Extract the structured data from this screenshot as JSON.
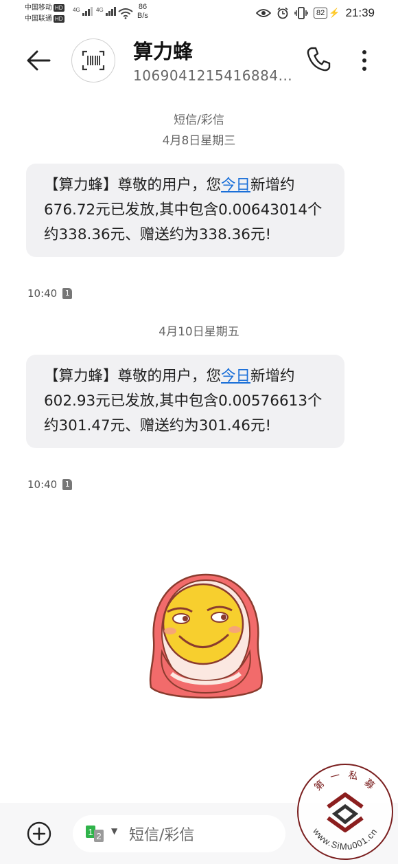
{
  "status_bar": {
    "carrier1": "中国移动",
    "carrier2": "中国联通",
    "hd_label": "HD",
    "net_type": "4G",
    "net_speed_value": "86",
    "net_speed_unit": "B/s",
    "battery": "82",
    "time": "21:39"
  },
  "header": {
    "title": "算力蜂",
    "number": "1069041215416884..."
  },
  "messages": {
    "type_label": "短信/彩信",
    "date1": "4月8日星期三",
    "msg1": {
      "text_before_link": "【算力蜂】尊敬的用户，您",
      "link": "今日",
      "text_after_link": "新增约676.72元已发放,其中包含0.00643014个约338.36元、赠送约为338.36元!",
      "time": "10:40",
      "sim": "1"
    },
    "date2": "4月10日星期五",
    "msg2": {
      "text_before_link": "【算力蜂】尊敬的用户，您",
      "link": "今日",
      "text_after_link": "新增约602.93元已发放,其中包含0.00576613个约301.47元、赠送约为301.46元!",
      "time": "10:40",
      "sim": "1"
    }
  },
  "composer": {
    "placeholder": "短信/彩信",
    "sim_label_1": "1",
    "sim_label_2": "2"
  },
  "watermark": {
    "top_text": "第 一 私 募",
    "url": "www.SiMu001.cn"
  }
}
